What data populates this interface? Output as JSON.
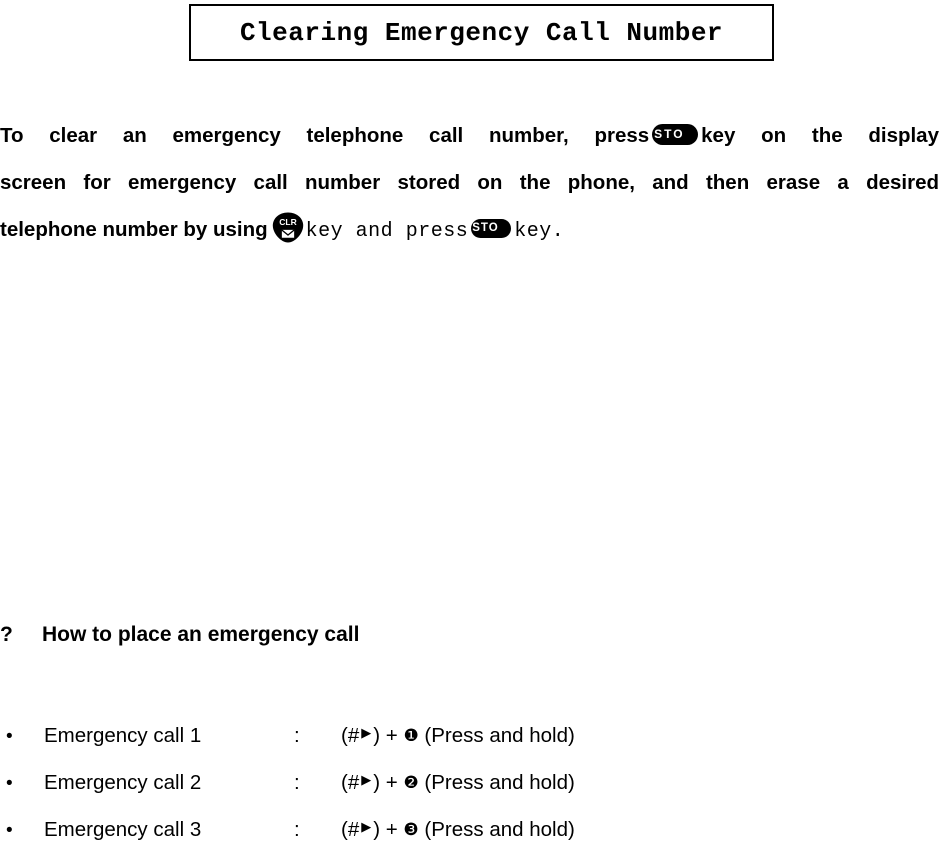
{
  "title": {
    "text": "Clearing Emergency Call Number"
  },
  "paragraph": {
    "line1_a": "To clear an emergency telephone call number, press",
    "key_sto_1": "STO",
    "line1_b": "key on the display",
    "line2": "screen for emergency call number stored on the phone, and then erase a desired",
    "line3_a": "telephone number by using",
    "key_clr_label": "CLR",
    "key_clr_glyph": "envelope",
    "line3_b": "key and press",
    "key_sto_2": "STO",
    "line3_c": "key."
  },
  "section": {
    "marker": "?",
    "heading": "How to place an emergency call"
  },
  "list": {
    "bullet": "•",
    "colon": ":",
    "items": [
      {
        "label": "Emergency call 1",
        "prefix": "(#",
        "arrow": "▶",
        "suffix": ") +",
        "number": "❶",
        "note": "(Press and hold)"
      },
      {
        "label": "Emergency call 2",
        "prefix": "(#",
        "arrow": "▶",
        "suffix": ") +",
        "number": "❷",
        "note": "(Press and hold)"
      },
      {
        "label": "Emergency call 3",
        "prefix": "(#",
        "arrow": "▶",
        "suffix": ") +",
        "number": "❸",
        "note": "(Press and hold)"
      }
    ]
  },
  "colors": {
    "text": "#000000",
    "background": "#ffffff",
    "key_fill": "#000000",
    "key_text": "#ffffff"
  }
}
